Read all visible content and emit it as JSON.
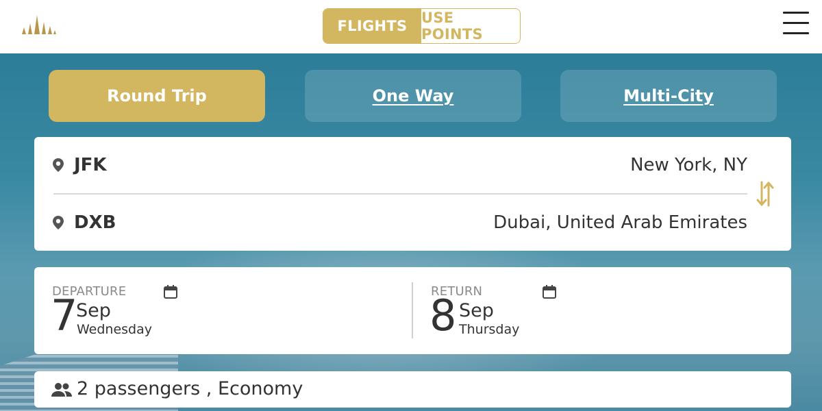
{
  "header": {
    "logo_icon": "tower-logo",
    "mode_tabs": [
      {
        "label": "FLIGHTS",
        "active": true
      },
      {
        "label": "USE POINTS",
        "active": false
      }
    ],
    "menu_icon": "hamburger-menu-icon"
  },
  "colors": {
    "accent_gold": "#d3b660",
    "hero_blue": "#3a89a3",
    "text_dark": "#333333",
    "label_gray": "#8a8a8a"
  },
  "trip_types": [
    {
      "label": "Round Trip",
      "active": true
    },
    {
      "label": "One Way",
      "active": false
    },
    {
      "label": "Multi-City",
      "active": false
    }
  ],
  "route": {
    "origin": {
      "code": "JFK",
      "city": "New York, NY",
      "icon": "location-pin-icon"
    },
    "destination": {
      "code": "DXB",
      "city": "Dubai, United Arab Emirates",
      "icon": "location-pin-icon"
    },
    "swap_icon": "swap-arrows-icon"
  },
  "dates": {
    "departure": {
      "label": "DEPARTURE",
      "day": "7",
      "month": "Sep",
      "weekday": "Wednesday",
      "icon": "calendar-icon"
    },
    "return": {
      "label": "RETURN",
      "day": "8",
      "month": "Sep",
      "weekday": "Thursday",
      "icon": "calendar-icon"
    }
  },
  "passengers": {
    "text": "2 passengers , Economy",
    "icon": "people-icon"
  }
}
